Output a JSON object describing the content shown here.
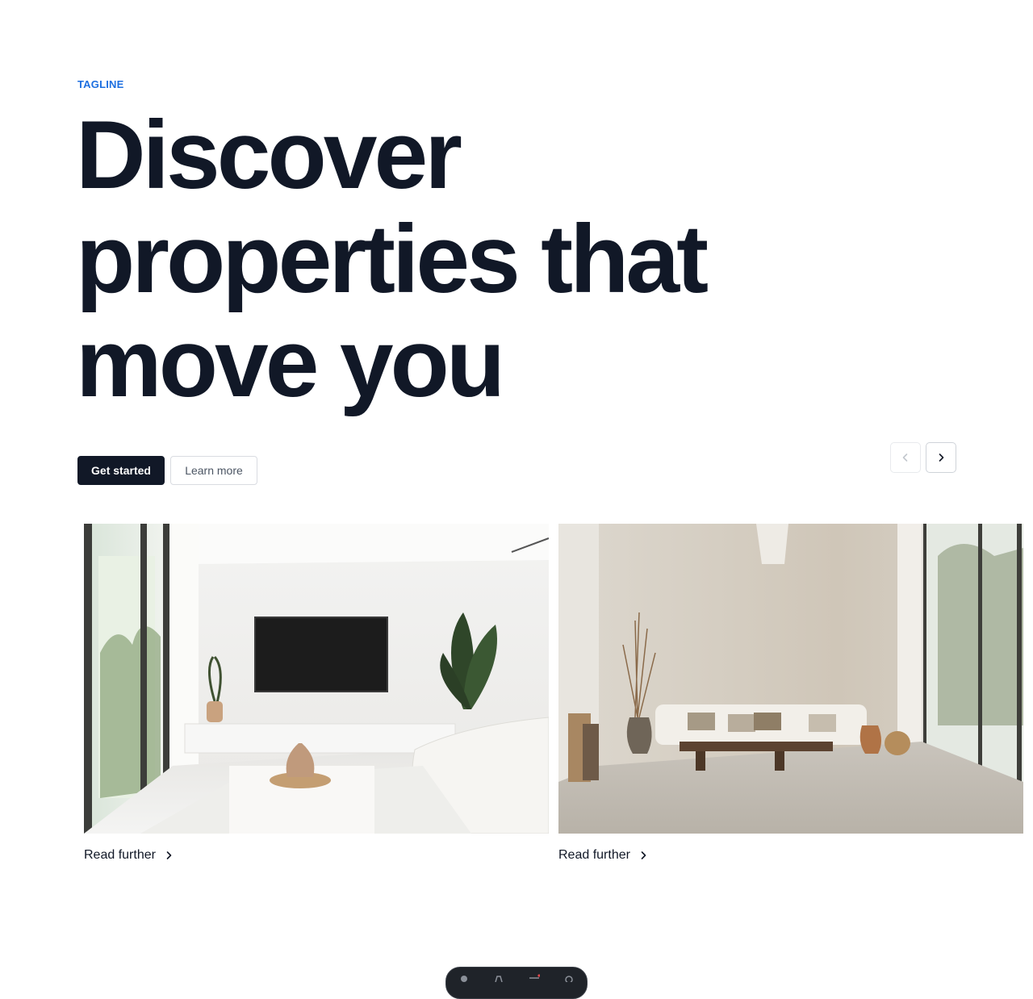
{
  "hero": {
    "tagline": "TAGLINE",
    "headline": "Discover properties that move you"
  },
  "actions": {
    "primary_label": "Get started",
    "secondary_label": "Learn more"
  },
  "carousel": {
    "prev_icon": "chevron-left-icon",
    "next_icon": "chevron-right-icon",
    "cards": [
      {
        "image": "white-living-room-photo",
        "link_label": "Read further"
      },
      {
        "image": "minimal-loft-living-room-photo",
        "link_label": "Read further"
      }
    ]
  },
  "colors": {
    "accent": "#1d6fe0",
    "text_dark": "#111827",
    "dock_bg": "#1f2329"
  },
  "dock": {
    "icons": [
      "person-icon",
      "hand-icon",
      "menu-icon",
      "gear-icon"
    ]
  }
}
